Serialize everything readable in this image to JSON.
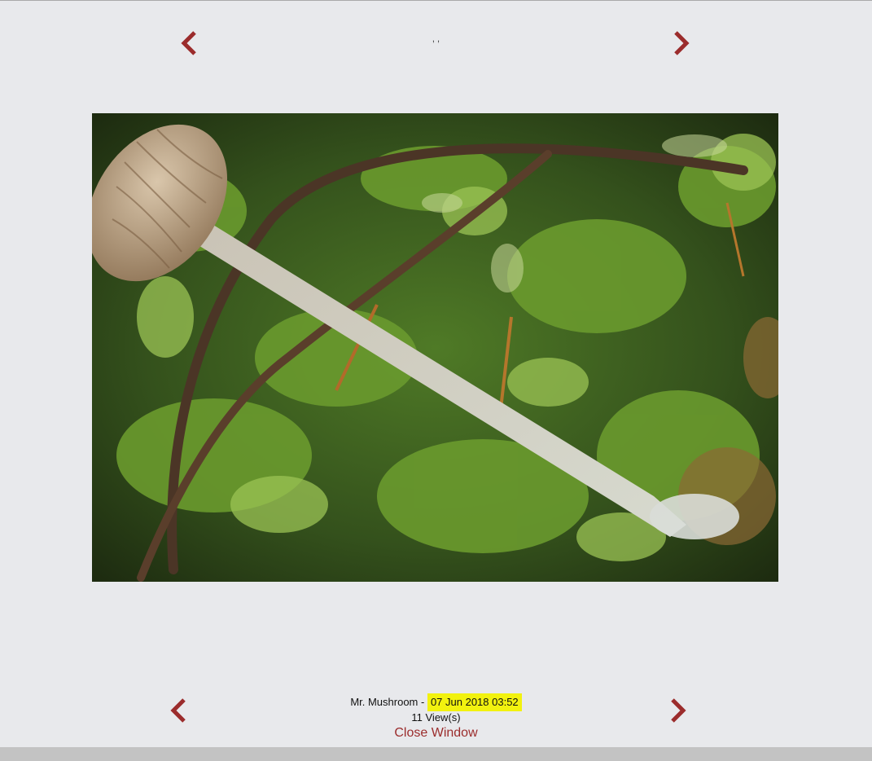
{
  "header": {
    "caption": ", ,"
  },
  "navigation": {
    "prev_icon": "chevron-left-icon",
    "next_icon": "chevron-right-icon",
    "arrow_color": "#9b2c2c"
  },
  "photo": {
    "subject": "mushroom-photo"
  },
  "footer": {
    "author": "Mr. Mushroom",
    "separator": " - ",
    "date": "07 Jun 2018 03:52",
    "views": "11 View(s)",
    "close_label": "Close Window",
    "highlight_color": "#f2f20f"
  }
}
